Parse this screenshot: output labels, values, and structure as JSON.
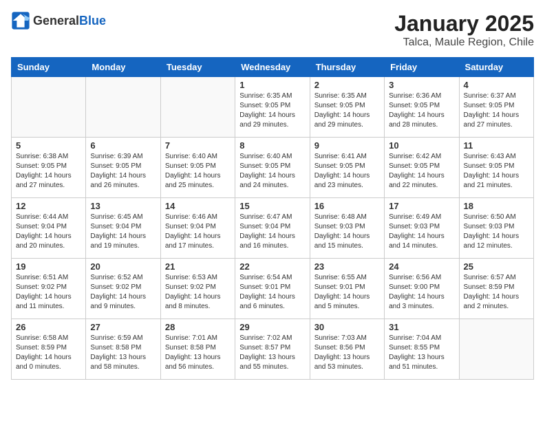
{
  "header": {
    "logo_general": "General",
    "logo_blue": "Blue",
    "month_year": "January 2025",
    "location": "Talca, Maule Region, Chile"
  },
  "weekdays": [
    "Sunday",
    "Monday",
    "Tuesday",
    "Wednesday",
    "Thursday",
    "Friday",
    "Saturday"
  ],
  "weeks": [
    [
      {
        "day": "",
        "sunrise": "",
        "sunset": "",
        "daylight": "",
        "empty": true
      },
      {
        "day": "",
        "sunrise": "",
        "sunset": "",
        "daylight": "",
        "empty": true
      },
      {
        "day": "",
        "sunrise": "",
        "sunset": "",
        "daylight": "",
        "empty": true
      },
      {
        "day": "1",
        "sunrise": "Sunrise: 6:35 AM",
        "sunset": "Sunset: 9:05 PM",
        "daylight": "Daylight: 14 hours and 29 minutes."
      },
      {
        "day": "2",
        "sunrise": "Sunrise: 6:35 AM",
        "sunset": "Sunset: 9:05 PM",
        "daylight": "Daylight: 14 hours and 29 minutes."
      },
      {
        "day": "3",
        "sunrise": "Sunrise: 6:36 AM",
        "sunset": "Sunset: 9:05 PM",
        "daylight": "Daylight: 14 hours and 28 minutes."
      },
      {
        "day": "4",
        "sunrise": "Sunrise: 6:37 AM",
        "sunset": "Sunset: 9:05 PM",
        "daylight": "Daylight: 14 hours and 27 minutes."
      }
    ],
    [
      {
        "day": "5",
        "sunrise": "Sunrise: 6:38 AM",
        "sunset": "Sunset: 9:05 PM",
        "daylight": "Daylight: 14 hours and 27 minutes."
      },
      {
        "day": "6",
        "sunrise": "Sunrise: 6:39 AM",
        "sunset": "Sunset: 9:05 PM",
        "daylight": "Daylight: 14 hours and 26 minutes."
      },
      {
        "day": "7",
        "sunrise": "Sunrise: 6:40 AM",
        "sunset": "Sunset: 9:05 PM",
        "daylight": "Daylight: 14 hours and 25 minutes."
      },
      {
        "day": "8",
        "sunrise": "Sunrise: 6:40 AM",
        "sunset": "Sunset: 9:05 PM",
        "daylight": "Daylight: 14 hours and 24 minutes."
      },
      {
        "day": "9",
        "sunrise": "Sunrise: 6:41 AM",
        "sunset": "Sunset: 9:05 PM",
        "daylight": "Daylight: 14 hours and 23 minutes."
      },
      {
        "day": "10",
        "sunrise": "Sunrise: 6:42 AM",
        "sunset": "Sunset: 9:05 PM",
        "daylight": "Daylight: 14 hours and 22 minutes."
      },
      {
        "day": "11",
        "sunrise": "Sunrise: 6:43 AM",
        "sunset": "Sunset: 9:05 PM",
        "daylight": "Daylight: 14 hours and 21 minutes."
      }
    ],
    [
      {
        "day": "12",
        "sunrise": "Sunrise: 6:44 AM",
        "sunset": "Sunset: 9:04 PM",
        "daylight": "Daylight: 14 hours and 20 minutes."
      },
      {
        "day": "13",
        "sunrise": "Sunrise: 6:45 AM",
        "sunset": "Sunset: 9:04 PM",
        "daylight": "Daylight: 14 hours and 19 minutes."
      },
      {
        "day": "14",
        "sunrise": "Sunrise: 6:46 AM",
        "sunset": "Sunset: 9:04 PM",
        "daylight": "Daylight: 14 hours and 17 minutes."
      },
      {
        "day": "15",
        "sunrise": "Sunrise: 6:47 AM",
        "sunset": "Sunset: 9:04 PM",
        "daylight": "Daylight: 14 hours and 16 minutes."
      },
      {
        "day": "16",
        "sunrise": "Sunrise: 6:48 AM",
        "sunset": "Sunset: 9:03 PM",
        "daylight": "Daylight: 14 hours and 15 minutes."
      },
      {
        "day": "17",
        "sunrise": "Sunrise: 6:49 AM",
        "sunset": "Sunset: 9:03 PM",
        "daylight": "Daylight: 14 hours and 14 minutes."
      },
      {
        "day": "18",
        "sunrise": "Sunrise: 6:50 AM",
        "sunset": "Sunset: 9:03 PM",
        "daylight": "Daylight: 14 hours and 12 minutes."
      }
    ],
    [
      {
        "day": "19",
        "sunrise": "Sunrise: 6:51 AM",
        "sunset": "Sunset: 9:02 PM",
        "daylight": "Daylight: 14 hours and 11 minutes."
      },
      {
        "day": "20",
        "sunrise": "Sunrise: 6:52 AM",
        "sunset": "Sunset: 9:02 PM",
        "daylight": "Daylight: 14 hours and 9 minutes."
      },
      {
        "day": "21",
        "sunrise": "Sunrise: 6:53 AM",
        "sunset": "Sunset: 9:02 PM",
        "daylight": "Daylight: 14 hours and 8 minutes."
      },
      {
        "day": "22",
        "sunrise": "Sunrise: 6:54 AM",
        "sunset": "Sunset: 9:01 PM",
        "daylight": "Daylight: 14 hours and 6 minutes."
      },
      {
        "day": "23",
        "sunrise": "Sunrise: 6:55 AM",
        "sunset": "Sunset: 9:01 PM",
        "daylight": "Daylight: 14 hours and 5 minutes."
      },
      {
        "day": "24",
        "sunrise": "Sunrise: 6:56 AM",
        "sunset": "Sunset: 9:00 PM",
        "daylight": "Daylight: 14 hours and 3 minutes."
      },
      {
        "day": "25",
        "sunrise": "Sunrise: 6:57 AM",
        "sunset": "Sunset: 8:59 PM",
        "daylight": "Daylight: 14 hours and 2 minutes."
      }
    ],
    [
      {
        "day": "26",
        "sunrise": "Sunrise: 6:58 AM",
        "sunset": "Sunset: 8:59 PM",
        "daylight": "Daylight: 14 hours and 0 minutes."
      },
      {
        "day": "27",
        "sunrise": "Sunrise: 6:59 AM",
        "sunset": "Sunset: 8:58 PM",
        "daylight": "Daylight: 13 hours and 58 minutes."
      },
      {
        "day": "28",
        "sunrise": "Sunrise: 7:01 AM",
        "sunset": "Sunset: 8:58 PM",
        "daylight": "Daylight: 13 hours and 56 minutes."
      },
      {
        "day": "29",
        "sunrise": "Sunrise: 7:02 AM",
        "sunset": "Sunset: 8:57 PM",
        "daylight": "Daylight: 13 hours and 55 minutes."
      },
      {
        "day": "30",
        "sunrise": "Sunrise: 7:03 AM",
        "sunset": "Sunset: 8:56 PM",
        "daylight": "Daylight: 13 hours and 53 minutes."
      },
      {
        "day": "31",
        "sunrise": "Sunrise: 7:04 AM",
        "sunset": "Sunset: 8:55 PM",
        "daylight": "Daylight: 13 hours and 51 minutes."
      },
      {
        "day": "",
        "sunrise": "",
        "sunset": "",
        "daylight": "",
        "empty": true
      }
    ]
  ]
}
